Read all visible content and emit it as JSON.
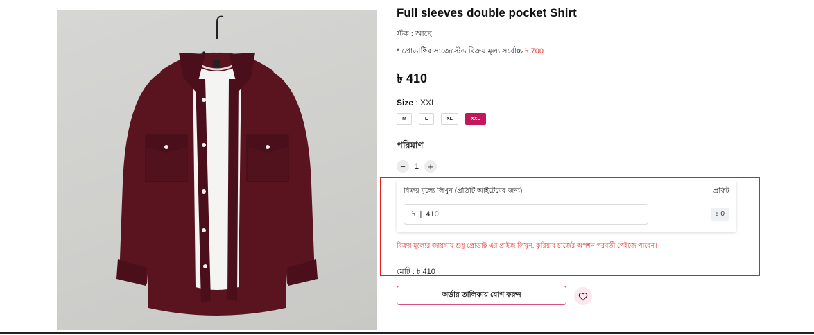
{
  "product": {
    "title": "Full sleeves double pocket Shirt",
    "stock_text": "স্টক : আছে",
    "suggested_prefix": "* প্রোডাক্টির সাজেস্টেড বিক্রয় মূল্য সর্বোচ্চ",
    "suggested_price": "৳ 700",
    "price": "৳ 410",
    "image_alt": "Maroon full sleeves shirt on hanger"
  },
  "size": {
    "label": "Size",
    "selected_text": ": XXL",
    "options": [
      "M",
      "L",
      "XL",
      "XXL"
    ],
    "selected_index": 3
  },
  "quantity": {
    "label": "পরিমাণ",
    "minus": "−",
    "value": "1",
    "plus": "+"
  },
  "resale": {
    "label": "বিক্রয় মূল্যে লিখুন (প্রতিটি আইটেমের জন্য)",
    "profit_label": "প্রফিট",
    "currency": "৳",
    "separator": "|",
    "value": "410",
    "profit_value": "৳ 0",
    "warning": "বিক্রয় মূল্যের জায়গায় শুধু প্রোডাক্ট এর প্রাইজ লিখুন, কুরিয়ার চার্জের অপশন পরবর্তী পেইজে পাবেন।",
    "total": "মোট : ৳ 410"
  },
  "actions": {
    "order_label": "অর্ডার তালিকায় যোগ করুন"
  },
  "colors": {
    "accent": "#c2185b",
    "warning": "#e53935",
    "highlight": "#e0201c",
    "shirt": "#5a1420"
  },
  "icons": {
    "wishlist": "heart-icon"
  }
}
